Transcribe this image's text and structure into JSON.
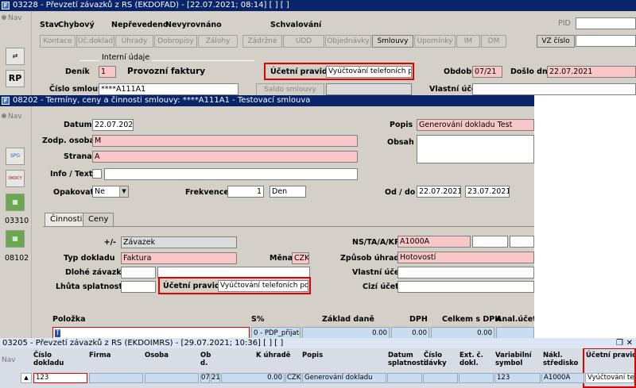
{
  "w1": {
    "title": "03228 - Převzetí závazků z RS (EKDOFAD) - [22.07.2021; 08:14]  [ ]  [ ]",
    "nav": "Nav",
    "status": [
      {
        "label": "Stav",
        "value": "Chybový"
      },
      {
        "label": "Nepřevedeno",
        "value": ""
      },
      {
        "label": "Nevyrovnáno",
        "value": ""
      },
      {
        "label": "Schvalování",
        "value": ""
      }
    ],
    "pid_label": "PID",
    "vz_label": "VZ číslo",
    "tabs": [
      "Kontace",
      "Úč.doklad",
      "Úhrady",
      "Dobropisy",
      "Zálohy",
      "Zádržné",
      "UDD",
      "Objednávky",
      "Smlouvy",
      "Upomínky",
      "IM",
      "DM"
    ],
    "section": "Interní údaje",
    "denik_label": "Deník",
    "denik_value": "1",
    "denik_name": "Provozní faktury",
    "ucetni_label": "Účetní pravidlo",
    "ucetni_value": "Vyúčtování telefoních popl",
    "obdobi_label": "Období",
    "obdobi_value": "07/21",
    "doslo_label": "Došlo dne",
    "doslo_value": "22.07.2021",
    "cislo_label": "Číslo smlouvy",
    "cislo_value": "****A111A1",
    "saldo_btn": "Saldo smlouvy",
    "vlastni_label": "Vlastní účet",
    "rp_label": "RP"
  },
  "w2": {
    "title": "08202 - Termíny, ceny a činnosti smlouvy: ****A111A1 - Testovací smlouva",
    "nav": "Nav",
    "side_items": [
      "SPG",
      "OKOCY",
      "03310",
      "08102"
    ],
    "datum_label": "Datum",
    "datum_value": "22.07.2021",
    "popis_label": "Popis",
    "popis_value": "Generování dokladu Test",
    "zodp_label": "Zodp. osoba",
    "zodp_value": "M",
    "obsah_label": "Obsah",
    "strana_label": "Strana",
    "strana_value": "A",
    "info_label": "Info / Text",
    "opakovat_label": "Opakovat",
    "opakovat_value": "Ne",
    "frekvence_label": "Frekvence",
    "frekvence_value": "1",
    "frekvence_unit": "Den",
    "od_label": "Od / do",
    "od_value": "22.07.2021",
    "do_value": "23.07.2021",
    "tab_cinnosti": "Činnosti",
    "tab_ceny": "Ceny",
    "pm_label": "+/-",
    "pm_value": "Závazek",
    "ns_label": "NS/TA/A/KP",
    "ns_value": "A1000A",
    "typ_label": "Typ dokladu",
    "typ_value": "Faktura",
    "mena_label": "Měna",
    "mena_value": "CZK",
    "zpusob_label": "Způsob úhrady",
    "zpusob_value": "Hotovostí",
    "dlouhe_label": "Dlohé závazků",
    "vlastni_label": "Vlastní účet",
    "lhuta_label": "Lhůta splatnosti",
    "ucetni_label": "Účetní pravidlo",
    "ucetni_value": "Vyúčtování telefoních poplat",
    "cizi_label": "Cizí účet",
    "grid_headers": [
      "Položka",
      "S%",
      "Základ daně",
      "DPH",
      "Celkem s DPH",
      "Anal.účet"
    ],
    "grid_row": {
      "polozka": "T",
      "s": "0 - PDP_přijatá",
      "zaklad": "0.00",
      "dph": "0.00",
      "celkem": "0.00"
    }
  },
  "w3": {
    "title": "03205 - Převzetí závazků z RS (EKDOIMRS) - [29.07.2021; 10:36]  [ ]  [ ]",
    "nav": "Nav",
    "headers": [
      {
        "line1": "Číslo",
        "line2": "dokladu"
      },
      {
        "line1": "",
        "line2": "Firma"
      },
      {
        "line1": "",
        "line2": "Osoba"
      },
      {
        "line1": "Ob",
        "line2": "d."
      },
      {
        "line1": "",
        "line2": "K úhradě"
      },
      {
        "line1": "",
        "line2": "Popis"
      },
      {
        "line1": "Datum",
        "line2": "splatnosti"
      },
      {
        "line1": "Číslo",
        "line2": "dávky"
      },
      {
        "line1": "Ext. č.",
        "line2": "dokl."
      },
      {
        "line1": "Variabilní",
        "line2": "symbol"
      },
      {
        "line1": "Nákl.",
        "line2": "středisko"
      },
      {
        "line1": "Účetní pravidlo",
        "line2": ""
      }
    ],
    "row": {
      "cislo": "123",
      "firma": "",
      "osoba": "",
      "ob1": "07",
      "ob2": "21",
      "uhrada": "0.00",
      "mena": "CZK",
      "popis": "Generování dokladu",
      "variabilni": "123",
      "stredisko": "A1000A",
      "ucetni": "Vyúčtování telefo"
    }
  }
}
